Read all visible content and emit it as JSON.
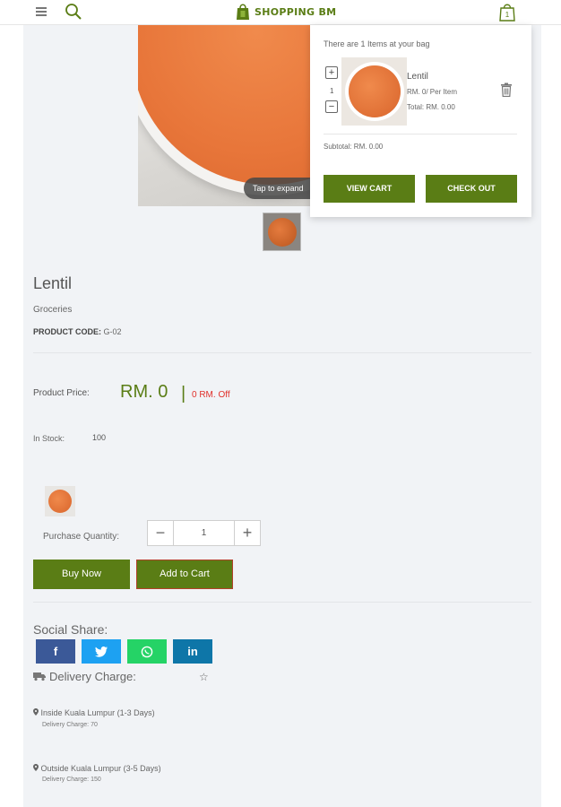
{
  "header": {
    "logo_text": "SHOPPING BM",
    "menu_icon": "hamburger-menu-icon",
    "search_icon": "search-icon",
    "bag_icon": "shopping-bag-icon"
  },
  "gallery": {
    "tap_hint": "Tap to expand"
  },
  "product": {
    "title": "Lentil",
    "category": "Groceries",
    "code_label": "PRODUCT CODE:",
    "code_value": "G-02",
    "price_label": "Product Price:",
    "price": "RM. 0",
    "price_separator": "|",
    "discount": "0 RM. Off",
    "stock_label": "In Stock:",
    "stock_value": "100",
    "quantity_label": "Purchase Quantity:",
    "quantity_value": "1",
    "minus_symbol": "−",
    "plus_symbol": "+",
    "buy_now_label": "Buy Now",
    "add_to_cart_label": "Add to Cart"
  },
  "social": {
    "label": "Social Share:",
    "buttons": [
      {
        "name": "facebook",
        "glyph": "f",
        "color": "#3b5998"
      },
      {
        "name": "twitter",
        "glyph": "t",
        "color": "#1da1f2"
      },
      {
        "name": "whatsapp",
        "glyph": "w",
        "color": "#25d366"
      },
      {
        "name": "linkedin",
        "glyph": "in",
        "color": "#0e76a8"
      }
    ]
  },
  "delivery": {
    "heading": "Delivery Charge:",
    "star_symbol": "☆",
    "zones": [
      {
        "area": "Inside Kuala Lumpur (1-3 Days)",
        "charge": "Delivery Charge: 70"
      },
      {
        "area": "Outside Kuala Lumpur (3-5 Days)",
        "charge": "Delivery Charge: 150"
      }
    ]
  },
  "cart": {
    "heading": "There are 1 Items at your bag",
    "item_name": "Lentil",
    "item_qty": "1",
    "item_price": "RM. 0/ Per Item",
    "item_total": "Total: RM. 0.00",
    "subtotal": "Subtotal: RM. 0.00",
    "view_cart_label": "VIEW CART",
    "checkout_label": "CHECK OUT",
    "plus_symbol": "+",
    "minus_symbol": "−"
  },
  "colors": {
    "brand_green": "#5a7d15",
    "discount_red": "#e0302b",
    "page_bg": "#f1f3f6"
  }
}
